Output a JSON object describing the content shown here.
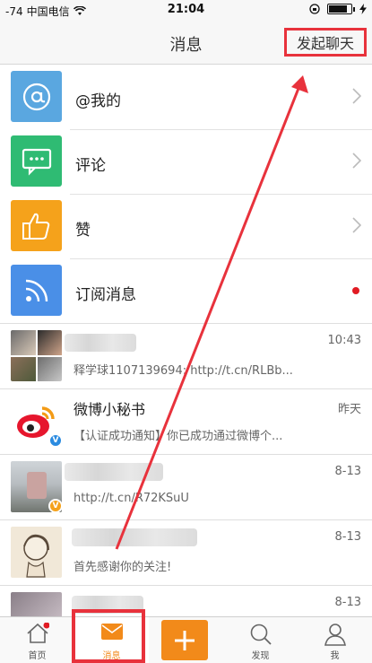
{
  "status_bar": {
    "signal": "-74",
    "carrier": "中国电信",
    "time": "21:04"
  },
  "nav": {
    "title": "消息",
    "action_label": "发起聊天"
  },
  "menu": [
    {
      "label": "@我的",
      "icon": "at-icon",
      "color": "#5aa7e0"
    },
    {
      "label": "评论",
      "icon": "comment-icon",
      "color": "#2fbb73"
    },
    {
      "label": "赞",
      "icon": "thumbs-up-icon",
      "color": "#f5a21b"
    },
    {
      "label": "订阅消息",
      "icon": "rss-icon",
      "color": "#4a8fe7"
    }
  ],
  "conversations": [
    {
      "name": "",
      "time": "10:43",
      "message": "释学球1107139694: http://t.cn/RLBb..."
    },
    {
      "name": "微博小秘书",
      "time": "昨天",
      "message": "【认证成功通知】你已成功通过微博个..."
    },
    {
      "name": "",
      "time": "8-13",
      "message": "http://t.cn/R72KSuU"
    },
    {
      "name": "",
      "time": "8-13",
      "message": "首先感谢你的关注!"
    },
    {
      "name": "",
      "time": "8-13",
      "message": ""
    }
  ],
  "tabs": [
    {
      "label": "首页",
      "icon": "home-icon"
    },
    {
      "label": "消息",
      "icon": "mail-icon"
    },
    {
      "label": "",
      "icon": "plus-icon"
    },
    {
      "label": "发现",
      "icon": "search-icon"
    },
    {
      "label": "我",
      "icon": "person-icon"
    }
  ],
  "colors": {
    "highlight": "#e8323c",
    "accent_orange": "#f28a1a",
    "unread_dot": "#e11b23"
  }
}
